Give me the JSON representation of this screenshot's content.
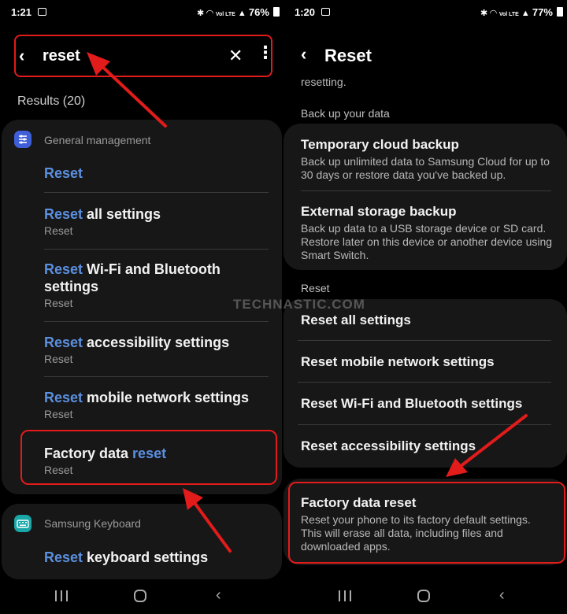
{
  "left": {
    "status": {
      "time": "1:21",
      "battery": "76%",
      "net_text": "Vol LTE"
    },
    "search": {
      "query": "reset"
    },
    "results_count": "Results (20)",
    "groups": [
      {
        "label": "General management",
        "icon_color": "#3f5fd8",
        "items": [
          {
            "highlight": "Reset",
            "rest": "",
            "sub": ""
          },
          {
            "highlight": "Reset",
            "rest": " all settings",
            "sub": "Reset"
          },
          {
            "highlight": "Reset",
            "rest": " Wi-Fi and Bluetooth settings",
            "sub": "Reset"
          },
          {
            "highlight": "Reset",
            "rest": " accessibility settings",
            "sub": "Reset"
          },
          {
            "highlight": "Reset",
            "rest": " mobile network settings",
            "sub": "Reset"
          },
          {
            "prefix": "Factory data ",
            "highlight": "reset",
            "sub": "Reset"
          }
        ]
      },
      {
        "label": "Samsung Keyboard",
        "icon_color": "#1aa7a7",
        "items": [
          {
            "highlight": "Reset",
            "rest": " keyboard settings",
            "sub": ""
          }
        ]
      }
    ]
  },
  "right": {
    "status": {
      "time": "1:20",
      "battery": "77%",
      "net_text": "Vol LTE"
    },
    "title": "Reset",
    "faded_text": "resetting.",
    "sections": {
      "backup_label": "Back up your data",
      "reset_label": "Reset"
    },
    "backup_options": [
      {
        "title": "Temporary cloud backup",
        "desc": "Back up unlimited data to Samsung Cloud for up to 30 days or restore data you've backed up."
      },
      {
        "title": "External storage backup",
        "desc": "Back up data to a USB storage device or SD card. Restore later on this device or another device using Smart Switch."
      }
    ],
    "reset_options": [
      {
        "title": "Reset all settings"
      },
      {
        "title": "Reset mobile network settings"
      },
      {
        "title": "Reset Wi-Fi and Bluetooth settings"
      },
      {
        "title": "Reset accessibility settings"
      }
    ],
    "factory": {
      "title": "Factory data reset",
      "desc": "Reset your phone to its factory default settings. This will erase all data, including files and downloaded apps."
    }
  },
  "watermark": "TECHNASTIC.COM",
  "colors": {
    "highlight_blue": "#5b8fe0",
    "annotation_red": "#e21b1b",
    "card_bg": "#171717"
  }
}
